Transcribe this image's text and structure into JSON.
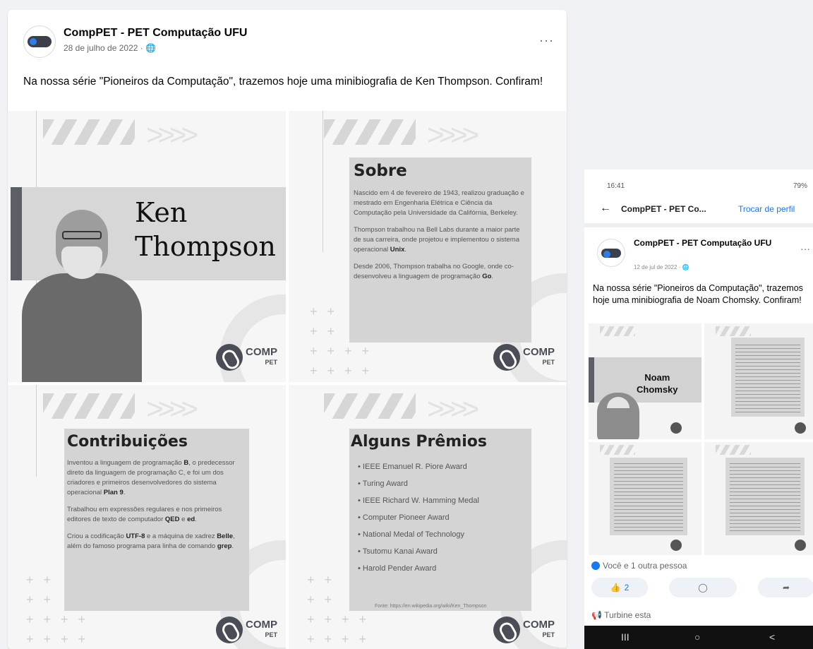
{
  "desktop_post": {
    "page_name": "CompPET - PET Computação UFU",
    "meta": "28 de julho de 2022 · 🌐",
    "more": "···",
    "text": "Na nossa série \"Pioneiros da Computação\", trazemos hoje uma minibiografia de Ken Thompson. Confiram!"
  },
  "slide1": {
    "name_line1": "Ken",
    "name_line2": "Thompson",
    "logo_word": "COMP",
    "logo_sub": "PET"
  },
  "slide2": {
    "title": "Sobre",
    "p1": "Nascido em 4 de fevereiro de 1943, realizou graduação e mestrado em Engenharia Elétrica e Ciência da Computação pela Universidade da Califórnia, Berkeley.",
    "p2a": "Thompson trabalhou na Bell Labs durante a maior parte de sua carreira, onde projetou e implementou o sistema operacional ",
    "p2b": "Unix",
    "p2c": ".",
    "p3a": "Desde 2006, Thompson trabalha no Google, onde co-desenvolveu a linguagem de programação ",
    "p3b": "Go",
    "p3c": "."
  },
  "slide3": {
    "title": "Contribuições",
    "p1a": "Inventou a linguagem de programação ",
    "p1b": "B",
    "p1c": ", o predecessor direto da linguagem de programação C, e foi um dos criadores e primeiros desenvolvedores do sistema operacional ",
    "p1d": "Plan 9",
    "p1e": ".",
    "p2a": "Trabalhou em expressões regulares e nos primeiros editores de texto de computador ",
    "p2b": "QED",
    "p2c": " e ",
    "p2d": "ed",
    "p2e": ".",
    "p3a": "Criou a codificação ",
    "p3b": "UTF-8",
    "p3c": " e a máquina de xadrez ",
    "p3d": "Belle",
    "p3e": ", além do famoso programa para linha de comando ",
    "p3f": "grep",
    "p3g": "."
  },
  "slide4": {
    "title": "Alguns Prêmios",
    "awards": [
      "IEEE Emanuel R. Piore Award",
      "Turing Award",
      "IEEE Richard W. Hamming Medal",
      "Computer Pioneer Award",
      "National Medal of Technology",
      "Tsutomu Kanai Award",
      "Harold Pender Award"
    ],
    "source": "Fonte: https://en.wikipedia.org/wiki/Ken_Thompson"
  },
  "phone": {
    "time": "16:41",
    "status_right": "79%",
    "nav_title": "CompPET - PET Co...",
    "nav_switch": "Trocar de perfil",
    "page_name": "CompPET - PET Computação UFU",
    "meta": "12 de jul de 2022 · 🌐",
    "more": "···",
    "text": "Na nossa série \"Pioneiros da Computação\", trazemos hoje uma minibiografia de Noam Chomsky. Confiram!",
    "slide_name_line1": "Noam",
    "slide_name_line2": "Chomsky",
    "reactions": "Você e 1 outra pessoa",
    "like_count": "2",
    "boost": "Turbine esta",
    "nav_buttons": [
      "III",
      "○",
      "<"
    ]
  },
  "colors": {
    "facebook_blue": "#1877f2",
    "slide_gray": "#d4d4d4",
    "accent_bar": "#5c5f66"
  }
}
